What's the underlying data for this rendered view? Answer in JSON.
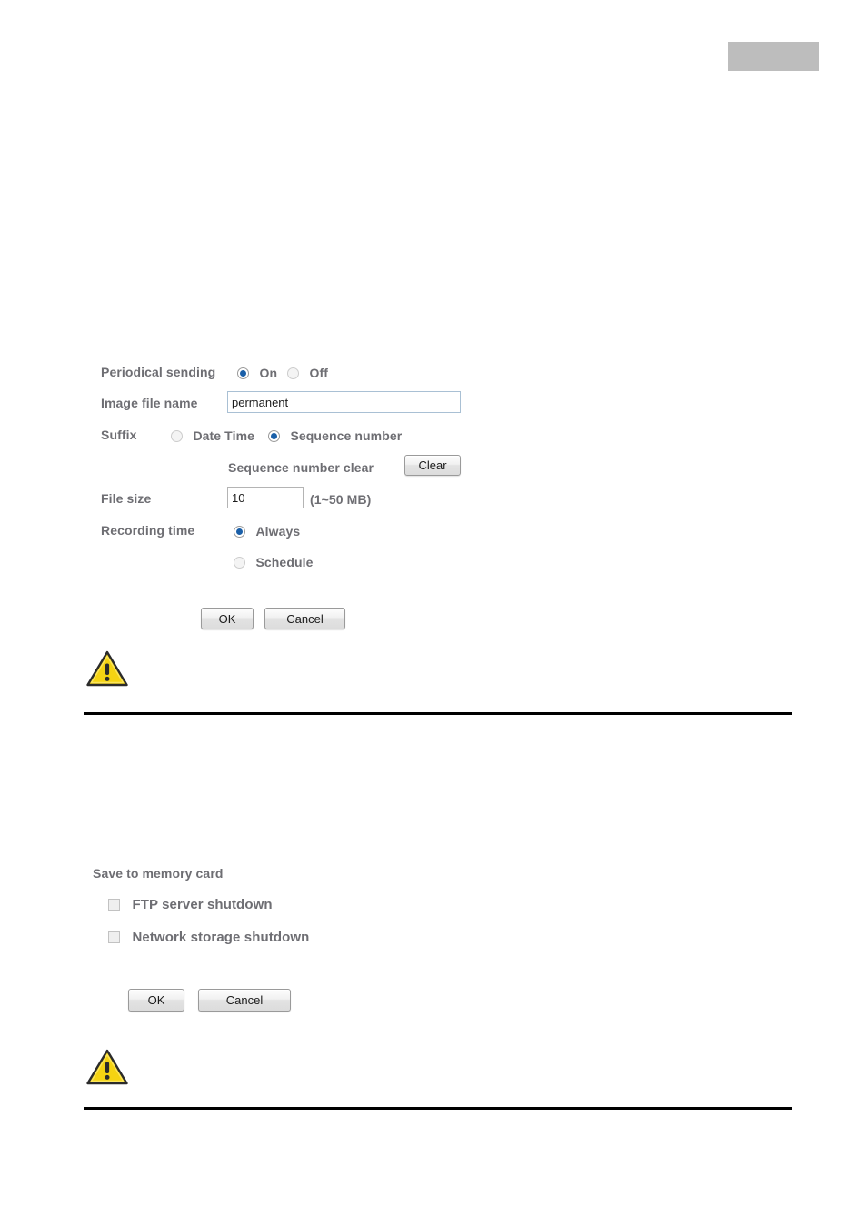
{
  "header": {
    "block_color": "#bdbdbd"
  },
  "section1": {
    "rows": {
      "periodical_sending": {
        "label": "Periodical sending",
        "options": [
          {
            "label": "On",
            "selected": true
          },
          {
            "label": "Off",
            "selected": false
          }
        ]
      },
      "image_file_name": {
        "label": "Image file name",
        "value": "permanent",
        "placeholder": ""
      },
      "suffix": {
        "label": "Suffix",
        "options": [
          {
            "label": "Date Time",
            "selected": false
          },
          {
            "label": "Sequence number",
            "selected": true
          }
        ]
      },
      "sequence_number_clear": {
        "label": "Sequence number clear",
        "button_label": "Clear"
      },
      "file_size": {
        "label": "File size",
        "value": "10",
        "placeholder": "",
        "hint": "(1~50 MB)"
      },
      "recording_time": {
        "label": "Recording time",
        "options": [
          {
            "label": "Always",
            "selected": true
          },
          {
            "label": "Schedule",
            "selected": false
          }
        ]
      }
    },
    "actions": {
      "ok_label": "OK",
      "cancel_label": "Cancel"
    },
    "warning_icon": "warning-triangle-icon"
  },
  "section2": {
    "heading": "Save to memory card",
    "checkboxes": [
      {
        "label": "FTP server shutdown",
        "checked": false
      },
      {
        "label": "Network storage shutdown",
        "checked": false
      }
    ],
    "actions": {
      "ok_label": "OK",
      "cancel_label": "Cancel"
    },
    "warning_icon": "warning-triangle-icon"
  },
  "colors": {
    "label_text": "#6e6e73",
    "input_border": "#a9c0d4",
    "radio_dot": "#1a5fa8",
    "warning_yellow": "#f5d312",
    "rule": "#000000"
  }
}
